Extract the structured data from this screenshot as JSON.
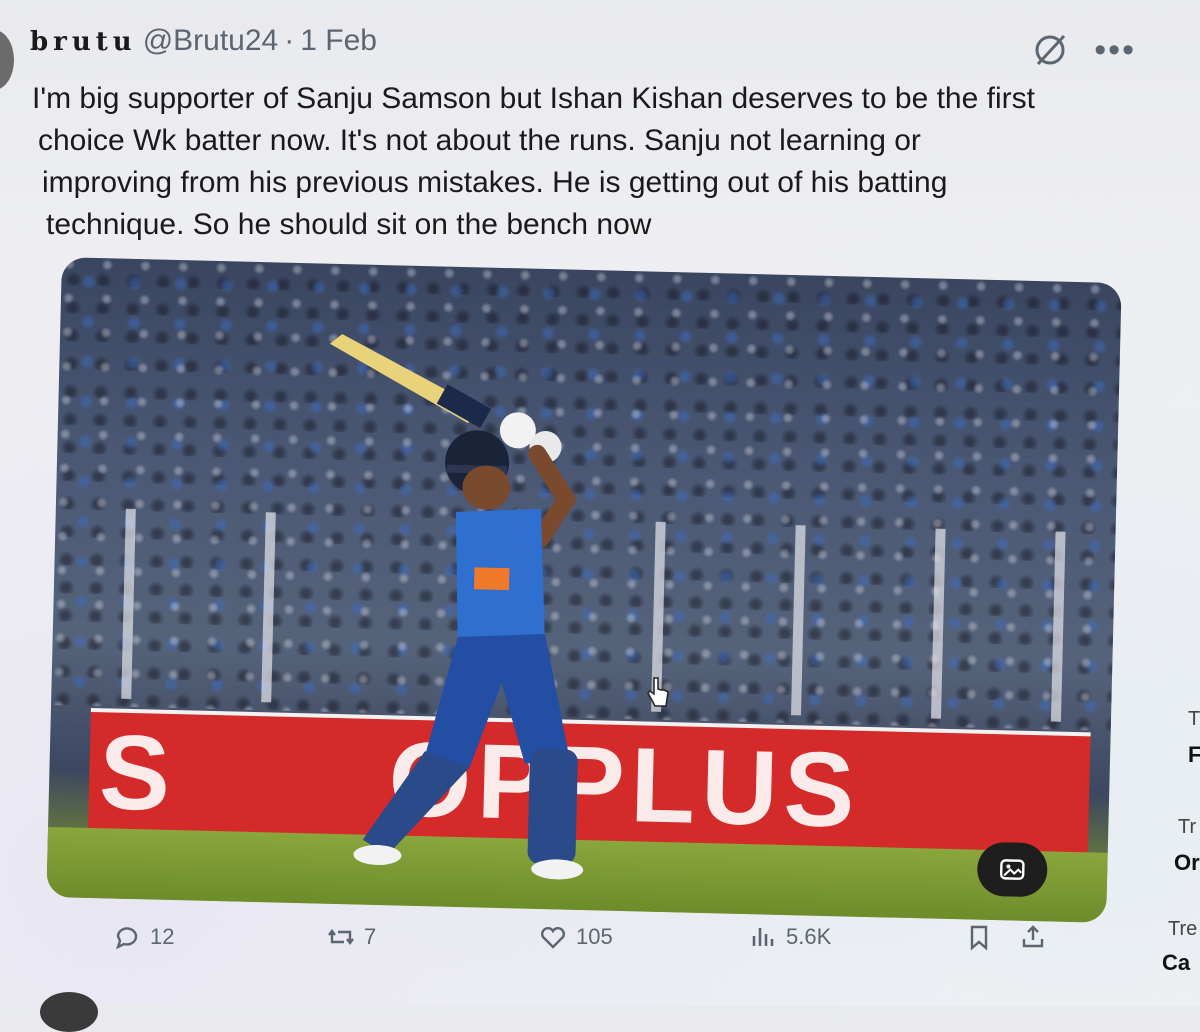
{
  "tweet": {
    "display_name": "brutu",
    "handle": "@Brutu24",
    "separator": "·",
    "date": "1 Feb",
    "text_lines": [
      "I'm big supporter of Sanju Samson but Ishan Kishan deserves to be the first",
      "choice Wk batter now. It's not about the runs. Sanju not learning or",
      "improving from his previous mistakes. He is getting out of his batting",
      "technique. So he should sit on the bench now"
    ],
    "media": {
      "hoarding_text": "S      OPPLUS",
      "alt_badge_icon": "image-alt-icon"
    },
    "actions": {
      "replies": "12",
      "reposts": "7",
      "likes": "105",
      "views": "5.6K"
    }
  },
  "sidebar_right": {
    "items": [
      "T",
      "F",
      "Tr",
      "Or",
      "Tre",
      "Ca"
    ]
  },
  "colors": {
    "accent_text": "#5b6670",
    "hoarding_red": "#d42a2a",
    "jersey_blue": "#2f6fd0"
  }
}
